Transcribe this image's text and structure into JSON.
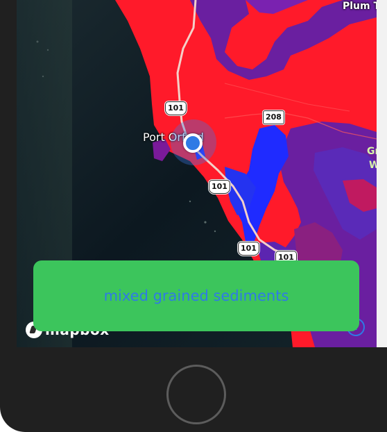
{
  "map": {
    "place_label": "Port Orford",
    "edge_label_top": "Plum T",
    "edge_label_green_1": "Gr",
    "edge_label_green_2": "W",
    "shields": {
      "us101_a": "101",
      "us101_b": "101",
      "us101_c": "101",
      "us101_d": "101",
      "or208": "208"
    },
    "attribution": "mapbox",
    "info_glyph": "i"
  },
  "toast": {
    "text": "mixed grained sediments"
  },
  "colors": {
    "sediment_red": "#ff1a2a",
    "sediment_purple": "#6a1fa0",
    "sediment_blue": "#1f2bff",
    "ocean": "#0d1922",
    "toast_bg": "#3cc55c",
    "toast_text": "#2f7ae5",
    "location_dot": "#2f7ae5"
  },
  "icons": [
    "location-dot-icon",
    "mapbox-logo-icon",
    "info-icon",
    "home-button-icon"
  ]
}
